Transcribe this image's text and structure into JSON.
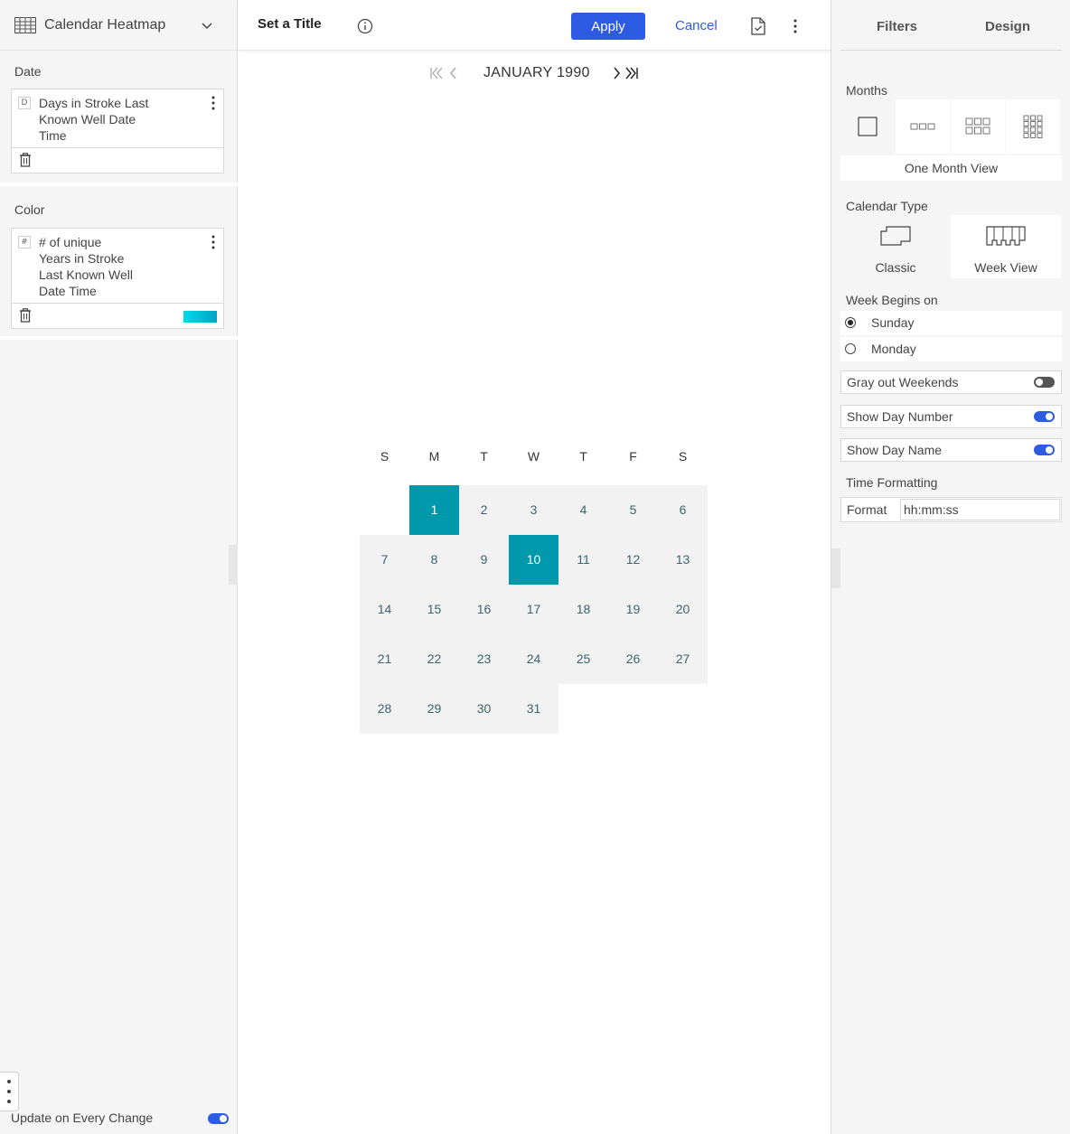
{
  "left_panel": {
    "viz_name": "Calendar Heatmap",
    "date_section_label": "Date",
    "date_field": {
      "type_badge": "D",
      "line1": "Days in Stroke Last",
      "line2": "Known Well Date",
      "line3": "Time"
    },
    "color_section_label": "Color",
    "color_field": {
      "type_badge": "#",
      "line1": "# of unique",
      "line2": "Years in Stroke",
      "line3": "Last Known Well",
      "line4": "Date Time",
      "gradient_start": "#00dbe8",
      "gradient_end": "#00a3c4"
    },
    "update_label": "Update on Every Change",
    "update_on": true
  },
  "toolbar": {
    "title": "Set a Title",
    "apply_label": "Apply",
    "cancel_label": "Cancel",
    "accent": "#2d5be3"
  },
  "calendar": {
    "month_label": "JANUARY 1990",
    "day_headers": [
      "S",
      "M",
      "T",
      "W",
      "T",
      "F",
      "S"
    ],
    "first_weekday_index": 1,
    "days_in_month": 31,
    "highlighted_days": [
      1,
      10
    ],
    "highlight_color": "#0099ab",
    "cell_color": "#f2f2f2"
  },
  "right_panel": {
    "tab_filters": "Filters",
    "tab_design": "Design",
    "months_label": "Months",
    "months_caption": "One Month View",
    "calendar_type_label": "Calendar Type",
    "calendar_type_classic": "Classic",
    "calendar_type_week": "Week View",
    "week_begins_label": "Week Begins on",
    "week_sunday": "Sunday",
    "week_monday": "Monday",
    "week_selected": "Sunday",
    "gray_weekends_label": "Gray out Weekends",
    "gray_weekends_on": false,
    "show_day_number_label": "Show Day Number",
    "show_day_number_on": true,
    "show_day_name_label": "Show Day Name",
    "show_day_name_on": true,
    "time_formatting_label": "Time Formatting",
    "format_label": "Format",
    "format_value": "hh:mm:ss"
  }
}
